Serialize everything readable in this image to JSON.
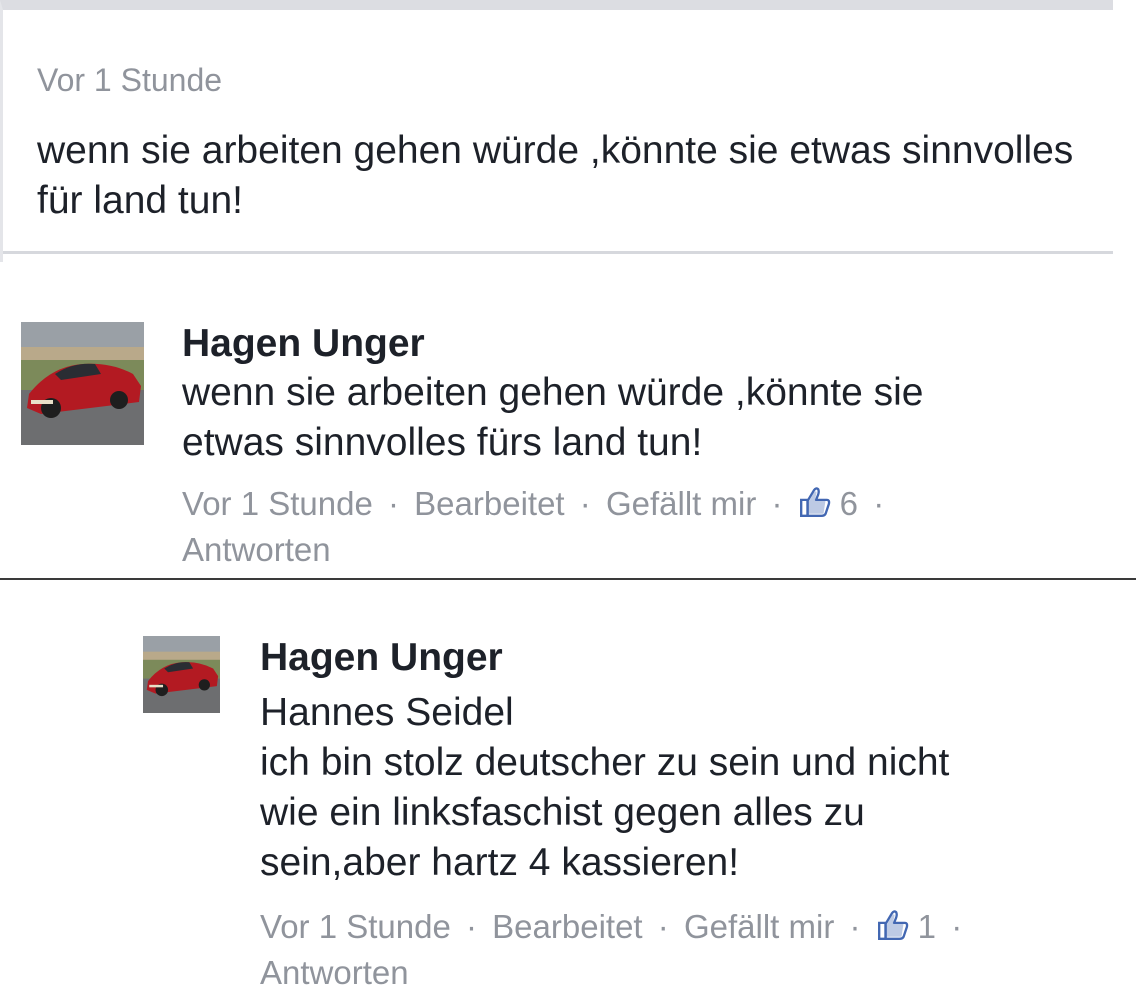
{
  "edit_box": {
    "meta": "Vor 1 Stunde",
    "body": "wenn sie arbeiten gehen würde ,könnte sie etwas sinnvolles für land tun!"
  },
  "comments": [
    {
      "author": "Hagen Unger",
      "lines": [
        "wenn sie arbeiten gehen würde ,könnte sie",
        "etwas sinnvolles fürs land tun!"
      ],
      "time": "Vor 1 Stunde",
      "edited": "Bearbeitet",
      "like": "Gefällt mir",
      "like_count": "6",
      "reply": "Antworten",
      "separator": "·",
      "avatar_icon": "car-avatar"
    },
    {
      "author": "Hagen Unger",
      "lines": [
        "Hannes Seidel",
        "ich bin stolz deutscher zu sein und nicht",
        "wie ein linksfaschist gegen alles zu",
        "sein,aber hartz 4 kassieren!"
      ],
      "time": "Vor 1 Stunde",
      "edited": "Bearbeitet",
      "like": "Gefällt mir",
      "like_count": "1",
      "reply": "Antworten",
      "separator": "·",
      "avatar_icon": "car-avatar"
    }
  ],
  "colors": {
    "text": "#1d2129",
    "meta": "#90949c",
    "like_icon": "#4267b2"
  },
  "icons": {
    "like": "thumbs-up-icon"
  }
}
